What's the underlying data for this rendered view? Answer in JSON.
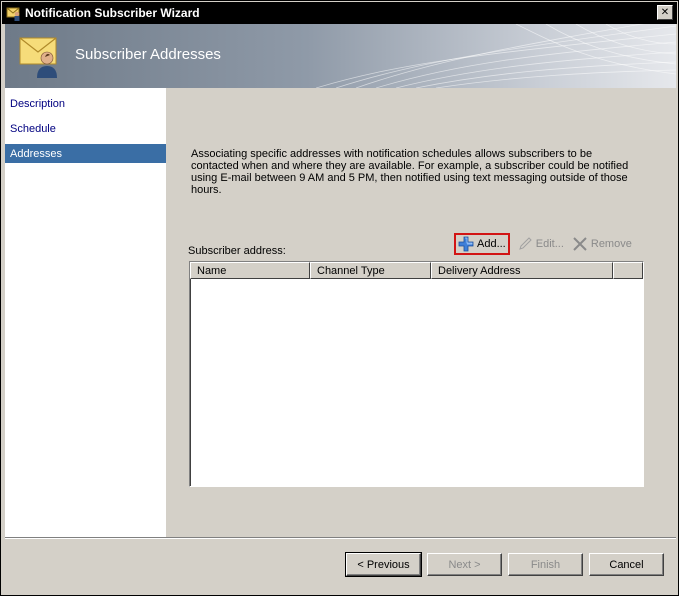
{
  "window": {
    "title": "Notification Subscriber Wizard",
    "close_glyph": "✕"
  },
  "banner": {
    "title": "Subscriber Addresses",
    "icon": "envelope-user-icon"
  },
  "sidebar": {
    "items": [
      {
        "label": "Description",
        "selected": false
      },
      {
        "label": "Schedule",
        "selected": false
      },
      {
        "label": "Addresses",
        "selected": true
      }
    ]
  },
  "main": {
    "description": "Associating specific addresses with notification schedules allows subscribers to be contacted when and where they are available. For example, a subscriber could be notified using E-mail between 9 AM and 5 PM, then notified using text messaging outside of those hours.",
    "address_label": "Subscriber address:",
    "toolbar": {
      "add_label": "Add...",
      "edit_label": "Edit...",
      "remove_label": "Remove"
    },
    "table": {
      "columns": [
        "Name",
        "Channel Type",
        "Delivery Address"
      ],
      "rows": []
    }
  },
  "footer": {
    "previous_label": "< Previous",
    "next_label": "Next >",
    "finish_label": "Finish",
    "cancel_label": "Cancel"
  },
  "colors": {
    "selection": "#3a6ea5",
    "highlight_border": "#d21414",
    "link": "#000080"
  }
}
